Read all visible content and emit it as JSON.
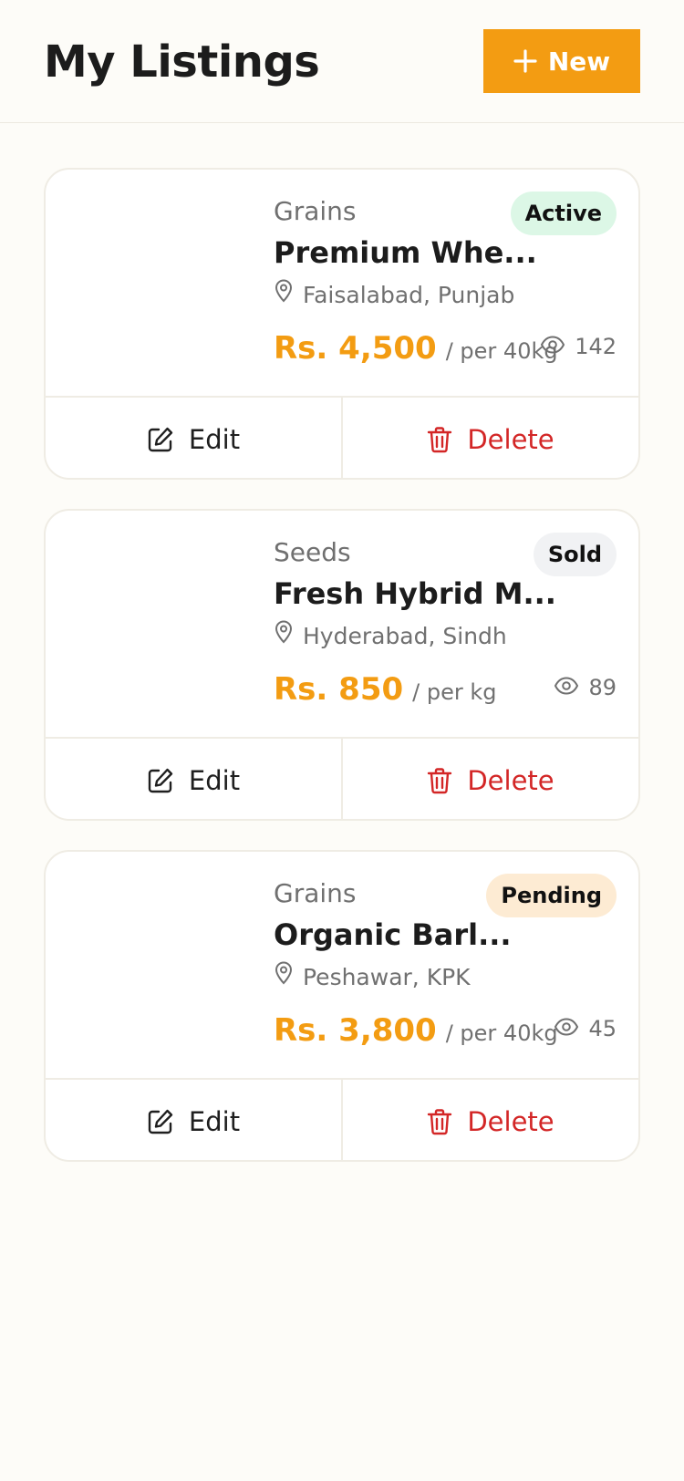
{
  "header": {
    "title": "My Listings",
    "new_button_label": "New"
  },
  "listings": [
    {
      "category": "Grains",
      "title": "Premium Whe...",
      "location": "Faisalabad, Punjab",
      "price": "Rs. 4,500",
      "unit": "/ per 40kg",
      "views": "142",
      "status": "Active",
      "status_bg": "#dcf7e6",
      "edit_label": "Edit",
      "delete_label": "Delete"
    },
    {
      "category": "Seeds",
      "title": "Fresh Hybrid M...",
      "location": "Hyderabad, Sindh",
      "price": "Rs. 850",
      "unit": "/ per kg",
      "views": "89",
      "status": "Sold",
      "status_bg": "#f1f2f4",
      "edit_label": "Edit",
      "delete_label": "Delete"
    },
    {
      "category": "Grains",
      "title": "Organic Barl...",
      "location": "Peshawar, KPK",
      "price": "Rs. 3,800",
      "unit": "/ per 40kg",
      "views": "45",
      "status": "Pending",
      "status_bg": "#fdebd3",
      "edit_label": "Edit",
      "delete_label": "Delete"
    }
  ],
  "colors": {
    "accent": "#f39c12",
    "danger": "#d32626",
    "background": "#fdfcf8"
  },
  "icons": {
    "new": "plus-icon",
    "location": "map-pin-icon",
    "views": "eye-icon",
    "edit": "edit-icon",
    "delete": "trash-icon"
  }
}
